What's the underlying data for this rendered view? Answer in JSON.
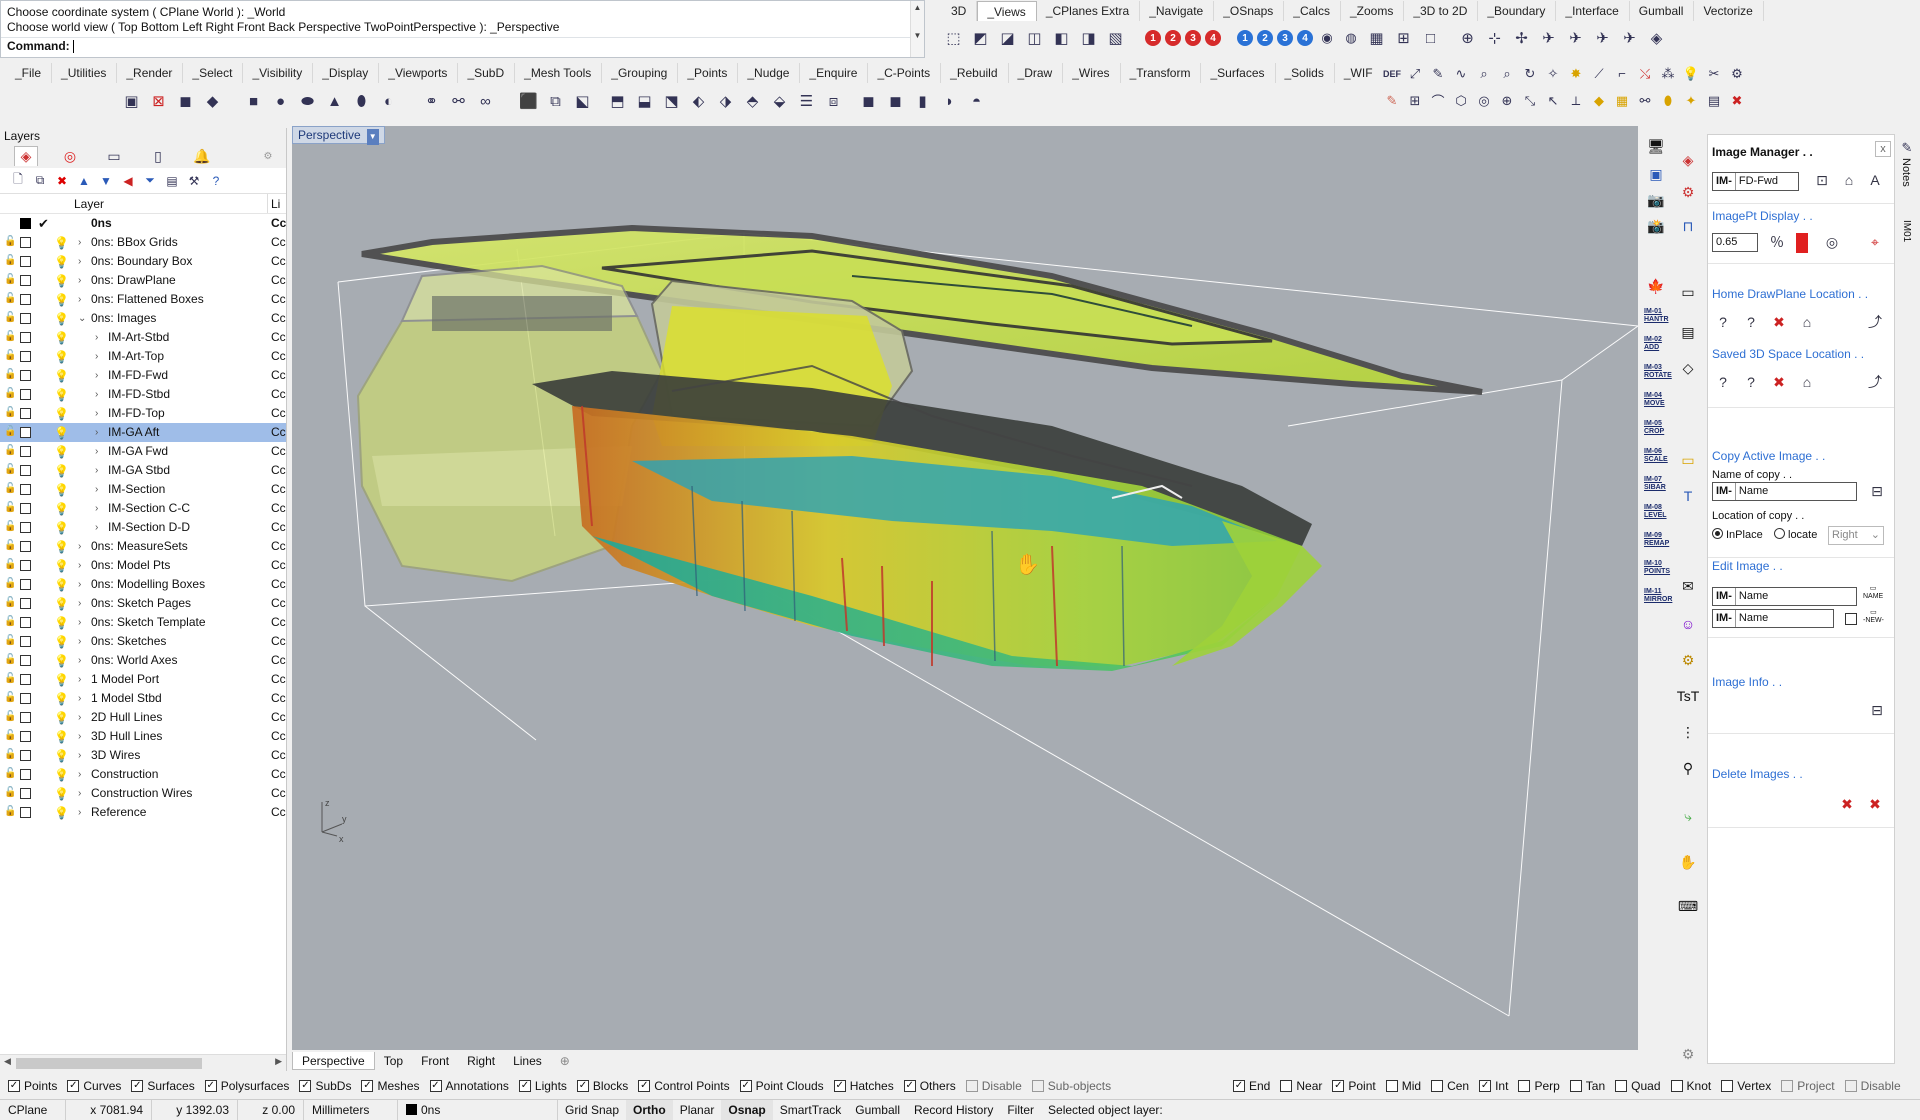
{
  "command": {
    "history": [
      "Choose coordinate system ( CPlane  World ): _World",
      "Choose world view ( Top  Bottom  Left  Right  Front  Back  Perspective  TwoPointPerspective ): _Perspective"
    ],
    "prompt": "Command:"
  },
  "tabs_top": [
    "3D",
    "_Views",
    "_CPlanes Extra",
    "_Navigate",
    "_OSnaps",
    "_Calcs",
    "_Zooms",
    "_3D to 2D",
    "_Boundary",
    "_Interface",
    "Gumball",
    "Vectorize"
  ],
  "tabs_top_active": "_Views",
  "numbered_buttons": [
    "1",
    "2",
    "3",
    "4",
    "1",
    "2",
    "3",
    "4"
  ],
  "tabs_main": [
    "_File",
    "_Utilities",
    "_Render",
    "_Select",
    "_Visibility",
    "_Display",
    "_Viewports",
    "_SubD",
    "_Mesh Tools",
    "_Grouping",
    "_Points",
    "_Nudge",
    "_Enquire",
    "_C-Points",
    "_Rebuild",
    "_Draw",
    "_Wires",
    "_Transform",
    "_Surfaces",
    "_Solids",
    "_WIF"
  ],
  "layers_panel": {
    "title": "Layers",
    "header_layer": "Layer",
    "header_material": "Li",
    "current_layer": "0ns",
    "rows": [
      {
        "name": "0ns: BBox Grids",
        "indent": 1,
        "expander": "›",
        "bulb": "blue",
        "material": "Cc"
      },
      {
        "name": "0ns: Boundary Box",
        "indent": 1,
        "expander": "›",
        "bulb": "blue",
        "material": "Cc"
      },
      {
        "name": "0ns: DrawPlane",
        "indent": 1,
        "expander": "›",
        "bulb": "blue",
        "material": "Cc"
      },
      {
        "name": "0ns: Flattened Boxes",
        "indent": 1,
        "expander": "›",
        "bulb": "blue",
        "material": "Cc"
      },
      {
        "name": "0ns: Images",
        "indent": 1,
        "expander": "⌄",
        "bulb": "yellow",
        "material": "Cc"
      },
      {
        "name": "IM-Art-Stbd",
        "indent": 2,
        "expander": "›",
        "bulb": "blue",
        "material": "Cc"
      },
      {
        "name": "IM-Art-Top",
        "indent": 2,
        "expander": "›",
        "bulb": "blue",
        "material": "Cc"
      },
      {
        "name": "IM-FD-Fwd",
        "indent": 2,
        "expander": "›",
        "bulb": "yellow",
        "material": "Cc"
      },
      {
        "name": "IM-FD-Stbd",
        "indent": 2,
        "expander": "›",
        "bulb": "yellow",
        "material": "Cc"
      },
      {
        "name": "IM-FD-Top",
        "indent": 2,
        "expander": "›",
        "bulb": "yellow",
        "material": "Cc"
      },
      {
        "name": "IM-GA Aft",
        "indent": 2,
        "expander": "›",
        "bulb": "blue",
        "material": "Cc",
        "selected": true
      },
      {
        "name": "IM-GA Fwd",
        "indent": 2,
        "expander": "›",
        "bulb": "blue",
        "material": "Cc"
      },
      {
        "name": "IM-GA Stbd",
        "indent": 2,
        "expander": "›",
        "bulb": "blue",
        "material": "Cc"
      },
      {
        "name": "IM-Section",
        "indent": 2,
        "expander": "›",
        "bulb": "blue",
        "material": "Cc"
      },
      {
        "name": "IM-Section C-C",
        "indent": 2,
        "expander": "›",
        "bulb": "blue",
        "material": "Cc"
      },
      {
        "name": "IM-Section D-D",
        "indent": 2,
        "expander": "›",
        "bulb": "blue",
        "material": "Cc"
      },
      {
        "name": "0ns: MeasureSets",
        "indent": 1,
        "expander": "›",
        "bulb": "blue",
        "material": "Cc"
      },
      {
        "name": "0ns: Model Pts",
        "indent": 1,
        "expander": "›",
        "bulb": "blue",
        "material": "Cc"
      },
      {
        "name": "0ns: Modelling Boxes",
        "indent": 1,
        "expander": "›",
        "bulb": "blue",
        "material": "Cc"
      },
      {
        "name": "0ns: Sketch Pages",
        "indent": 1,
        "expander": "›",
        "bulb": "yellow",
        "material": "Cc"
      },
      {
        "name": "0ns: Sketch Template",
        "indent": 1,
        "expander": "›",
        "bulb": "blue",
        "material": "Cc"
      },
      {
        "name": "0ns: Sketches",
        "indent": 1,
        "expander": "›",
        "bulb": "blue",
        "material": "Cc"
      },
      {
        "name": "0ns: World Axes",
        "indent": 1,
        "expander": "›",
        "bulb": "blue",
        "material": "Cc"
      },
      {
        "name": "1 Model Port",
        "indent": 1,
        "expander": "›",
        "bulb": "yellow",
        "material": "Cc"
      },
      {
        "name": "1 Model Stbd",
        "indent": 1,
        "expander": "›",
        "bulb": "blue",
        "material": "Cc"
      },
      {
        "name": "2D Hull Lines",
        "indent": 1,
        "expander": "›",
        "bulb": "blue",
        "material": "Cc"
      },
      {
        "name": "3D Hull Lines",
        "indent": 1,
        "expander": "›",
        "bulb": "blue",
        "material": "Cc"
      },
      {
        "name": "3D Wires",
        "indent": 1,
        "expander": "›",
        "bulb": "blue",
        "material": "Cc"
      },
      {
        "name": "Construction",
        "indent": 1,
        "expander": "›",
        "bulb": "blue",
        "material": "Cc"
      },
      {
        "name": "Construction Wires",
        "indent": 1,
        "expander": "›",
        "bulb": "blue",
        "material": "Cc"
      },
      {
        "name": "Reference",
        "indent": 1,
        "expander": "›",
        "bulb": "blue",
        "material": "Cc"
      }
    ]
  },
  "viewport": {
    "title": "Perspective",
    "tabs": [
      "Perspective",
      "Top",
      "Front",
      "Right",
      "Lines"
    ],
    "active_tab": "Perspective",
    "axis_z": "z",
    "axis_y": "y",
    "axis_x": "x"
  },
  "side_strip_labels": [
    "IM-01\nHANTR",
    "IM-02\nADD",
    "IM-03\nROTATE",
    "IM-04\nMOVE",
    "IM-05\nCROP",
    "IM-06\nSCALE",
    "IM-07\nSIBAR",
    "IM-08\nLEVEL",
    "IM-09\nREMAP",
    "IM-10\nPOINTS",
    "IM-11\nMIRROR"
  ],
  "image_manager": {
    "title": "Image Manager . .",
    "prefix": "IM-",
    "current_image": "FD-Fwd",
    "imagept_display": "ImagePt Display . .",
    "opacity": "0.65",
    "home_drawplane": "Home DrawPlane Location . .",
    "saved_3d": "Saved 3D Space Location . .",
    "copy_active": "Copy Active Image . .",
    "name_of_copy": "Name of copy . .",
    "name_placeholder": "Name",
    "location_of_copy": "Location of copy . .",
    "inplace": "InPlace",
    "locate": "locate",
    "locate_side": "Right",
    "edit_image": "Edit Image . .",
    "name_btn": "NAME",
    "new_btn": "-NEW-",
    "image_info": "Image Info . .",
    "delete_images": "Delete Images . .",
    "notes_tab": "Notes",
    "im01_tab": "IM01"
  },
  "filter_bar": {
    "items": [
      {
        "label": "Points",
        "checked": true
      },
      {
        "label": "Curves",
        "checked": true
      },
      {
        "label": "Surfaces",
        "checked": true
      },
      {
        "label": "Polysurfaces",
        "checked": true
      },
      {
        "label": "SubDs",
        "checked": true
      },
      {
        "label": "Meshes",
        "checked": true
      },
      {
        "label": "Annotations",
        "checked": true
      },
      {
        "label": "Lights",
        "checked": true
      },
      {
        "label": "Blocks",
        "checked": true
      },
      {
        "label": "Control Points",
        "checked": true
      },
      {
        "label": "Point Clouds",
        "checked": true
      },
      {
        "label": "Hatches",
        "checked": true
      },
      {
        "label": "Others",
        "checked": true
      },
      {
        "label": "Disable",
        "checked": false,
        "disabled": true
      },
      {
        "label": "Sub-objects",
        "checked": false,
        "disabled": true
      }
    ],
    "osnaps": [
      {
        "label": "End",
        "checked": true
      },
      {
        "label": "Near",
        "checked": false
      },
      {
        "label": "Point",
        "checked": true
      },
      {
        "label": "Mid",
        "checked": false
      },
      {
        "label": "Cen",
        "checked": false
      },
      {
        "label": "Int",
        "checked": true
      },
      {
        "label": "Perp",
        "checked": false
      },
      {
        "label": "Tan",
        "checked": false
      },
      {
        "label": "Quad",
        "checked": false
      },
      {
        "label": "Knot",
        "checked": false
      },
      {
        "label": "Vertex",
        "checked": false
      },
      {
        "label": "Project",
        "checked": false,
        "disabled": true
      },
      {
        "label": "Disable",
        "checked": false,
        "disabled": true
      }
    ]
  },
  "status": {
    "cplane": "CPlane",
    "x": "x 7081.94",
    "y": "y 1392.03",
    "z": "z 0.00",
    "units": "Millimeters",
    "layer": "0ns",
    "panes": [
      {
        "label": "Grid Snap",
        "on": false
      },
      {
        "label": "Ortho",
        "on": true
      },
      {
        "label": "Planar",
        "on": false
      },
      {
        "label": "Osnap",
        "on": true
      },
      {
        "label": "SmartTrack",
        "on": false
      },
      {
        "label": "Gumball",
        "on": false
      },
      {
        "label": "Record History",
        "on": false
      },
      {
        "label": "Filter",
        "on": false
      }
    ],
    "message": "Selected object layer:"
  },
  "colors": {
    "viewport_bg": "#a7acb2",
    "hull_green": "#b5d43a",
    "selection_blue": "#9fbde8",
    "link_blue": "#2e6fd3"
  }
}
